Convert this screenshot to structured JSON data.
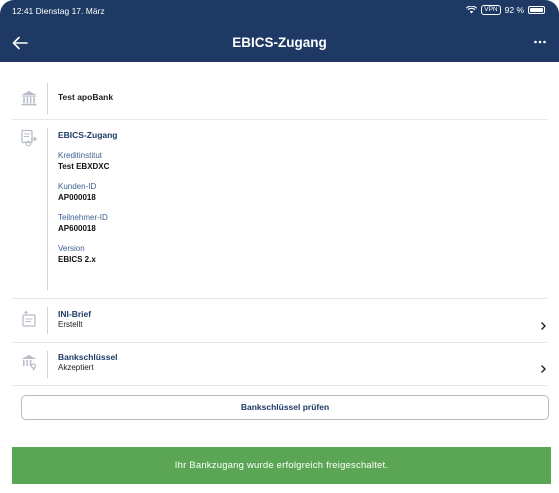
{
  "status_bar": {
    "time": "12:41",
    "date": "Dienstag 17. März",
    "vpn": "VPN",
    "battery": "92 %"
  },
  "nav": {
    "title": "EBICS-Zugang",
    "back_icon": "arrow-left-icon",
    "more_icon": "ellipsis-icon"
  },
  "bank": {
    "name": "Test apoBank",
    "icon": "bank-icon"
  },
  "ebics": {
    "title": "EBICS-Zugang",
    "icon": "ebics-access-icon",
    "fields": [
      {
        "label": "Kreditinstitut",
        "value": "Test EBXDXC"
      },
      {
        "label": "Kunden-ID",
        "value": "AP000018"
      },
      {
        "label": "Teilnehmer-ID",
        "value": "AP600018"
      },
      {
        "label": "Version",
        "value": "EBICS 2.x"
      }
    ]
  },
  "ini_brief": {
    "title": "INI-Brief",
    "status": "Erstellt",
    "icon": "letter-icon"
  },
  "bankschluessel": {
    "title": "Bankschlüssel",
    "status": "Akzeptiert",
    "icon": "bank-key-icon"
  },
  "actions": {
    "check_label": "Bankschlüssel prüfen"
  },
  "toast": {
    "message": "Ihr Bankzugang wurde erfolgreich freigeschaltet."
  },
  "colors": {
    "header": "#1e3a64",
    "accent_text": "#1e3a64",
    "toast": "#5ba654",
    "icon": "#9aa3ad"
  }
}
